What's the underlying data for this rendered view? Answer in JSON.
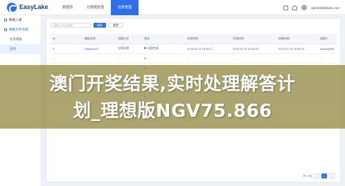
{
  "header": {
    "brand": "EasyLake",
    "tabs": [
      {
        "label": "数据源"
      },
      {
        "label": "元数据管理"
      },
      {
        "label": "任务管理"
      }
    ],
    "user": "admin@dtstack.com"
  },
  "sidebar": {
    "items": [
      {
        "label": "数据入湖"
      },
      {
        "label": "数据文件治理"
      },
      {
        "label": "任务模板"
      },
      {
        "label": "任务"
      }
    ]
  },
  "toolbar": {
    "search_placeholder": "请输入任务名称",
    "search_button": "搜索",
    "reset_button": "重置"
  },
  "table": {
    "columns": [
      "ID",
      "模板名称",
      "治理方式",
      "状态",
      "计划时间",
      "开始时间",
      "结束时间",
      "创建人"
    ],
    "rows": [
      {
        "id": "9",
        "name": "lingliang111",
        "mode": "立即治理",
        "status": "治理完成",
        "planned": "2023-04-14 16:46:17",
        "start": "2023-04-14 16:46:23",
        "end": "2023-04-14 16:46:23",
        "creator": "admin@dts"
      },
      {
        "id": "…",
        "name": "…",
        "mode": "…",
        "status": "…",
        "planned": "…",
        "start": "…",
        "end": "…",
        "creator": "…"
      },
      {
        "id": "…",
        "name": "…",
        "mode": "…",
        "status": "…",
        "planned": "…",
        "start": "…",
        "end": "…",
        "creator": "…"
      },
      {
        "id": "…",
        "name": "…",
        "mode": "…",
        "status": "…",
        "planned": "…",
        "start": "…",
        "end": "…",
        "creator": "…"
      },
      {
        "id": "…",
        "name": "…",
        "mode": "…",
        "status": "…",
        "planned": "…",
        "start": "…",
        "end": "…",
        "creator": "…"
      },
      {
        "id": "…",
        "name": "…",
        "mode": "…",
        "status": "…",
        "planned": "…",
        "start": "…",
        "end": "…",
        "creator": "…"
      }
    ]
  },
  "pager": {
    "total": "共 9 条",
    "pages": [
      "1"
    ]
  },
  "overlay": {
    "line1": "澳门开奖结果,实时处理解答计",
    "line2": "划_理想版NGV75.866"
  }
}
